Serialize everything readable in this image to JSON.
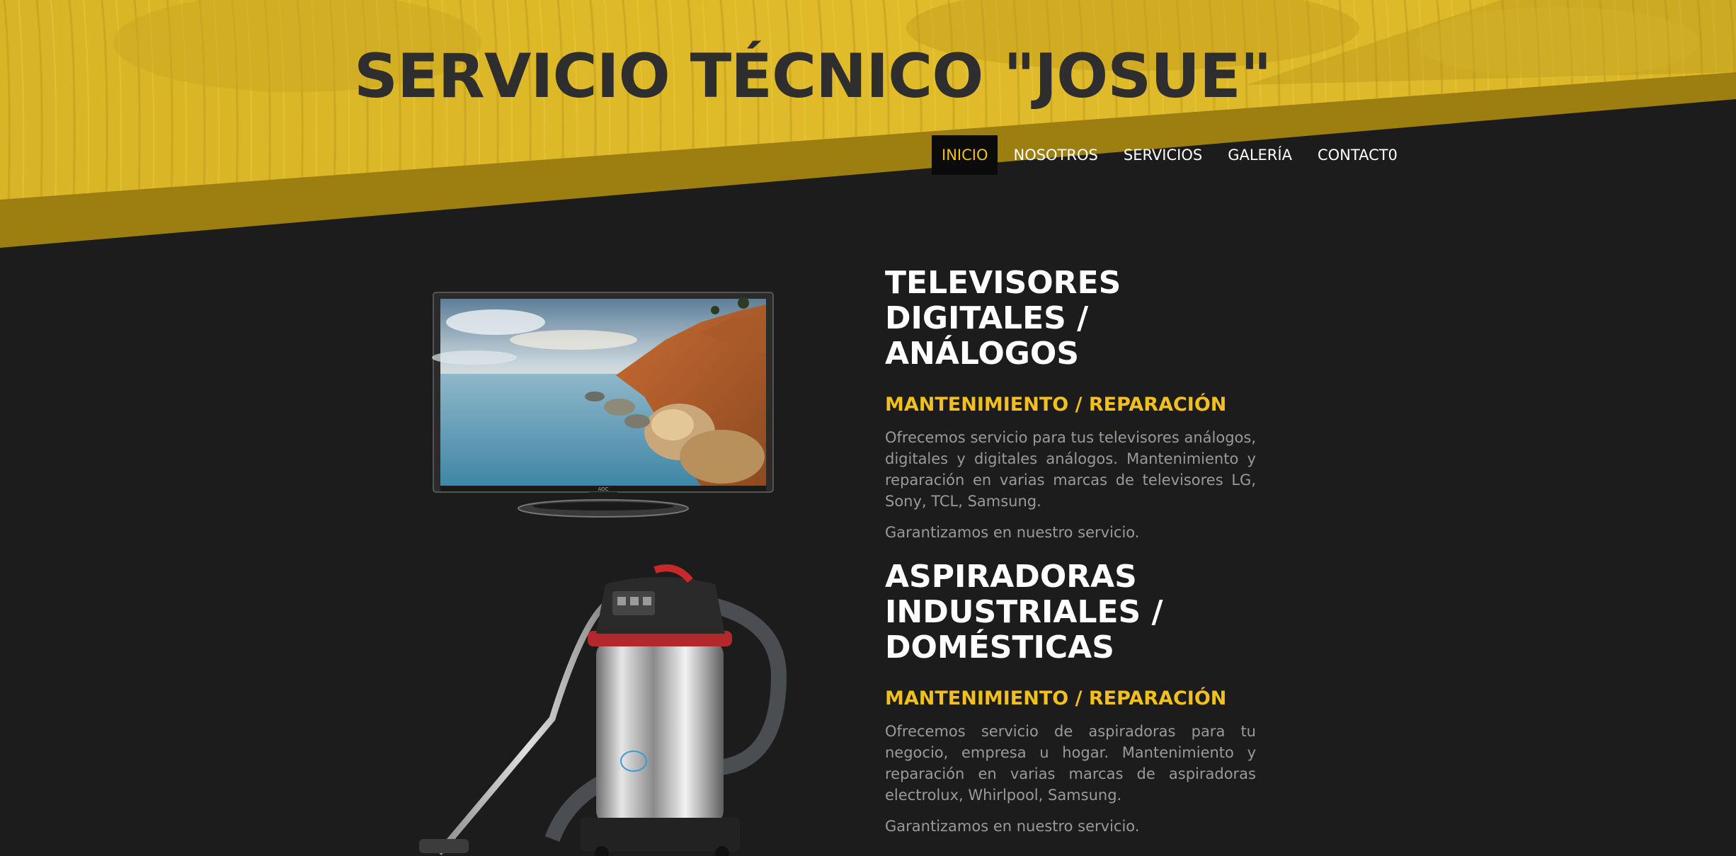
{
  "site": {
    "title": "SERVICIO TÉCNICO \"JOSUE\""
  },
  "nav": {
    "items": [
      {
        "label": "INICIO",
        "active": true
      },
      {
        "label": "NOSOTROS",
        "active": false
      },
      {
        "label": "SERVICIOS",
        "active": false
      },
      {
        "label": "GALERÍA",
        "active": false
      },
      {
        "label": "CONTACT0",
        "active": false
      }
    ]
  },
  "services": [
    {
      "title": "TELEVISORES DIGITALES / ANÁLOGOS",
      "subtitle": "MANTENIMIENTO / REPARACIÓN",
      "description": "Ofrecemos servicio para tus televisores análogos, digitales y digitales análogos. Mantenimiento y reparación en varias marcas de televisores LG, Sony, TCL, Samsung.",
      "guarantee": "Garantizamos en nuestro servicio.",
      "image_icon": "television-image"
    },
    {
      "title": "ASPIRADORAS INDUSTRIALES / DOMÉSTICAS",
      "subtitle": "MANTENIMIENTO / REPARACIÓN",
      "description": "Ofrecemos servicio de aspiradoras para tu negocio, empresa u hogar. Mantenimiento y reparación en varias marcas de aspiradoras electrolux, Whirlpool, Samsung.",
      "guarantee": "Garantizamos en nuestro servicio.",
      "image_icon": "vacuum-cleaner-image"
    }
  ],
  "colors": {
    "accent": "#f2c01e",
    "header_yellow": "#d9b526",
    "background": "#1c1c1c",
    "title_dark": "#2e2e2e",
    "body_text": "#9a9a9a"
  }
}
